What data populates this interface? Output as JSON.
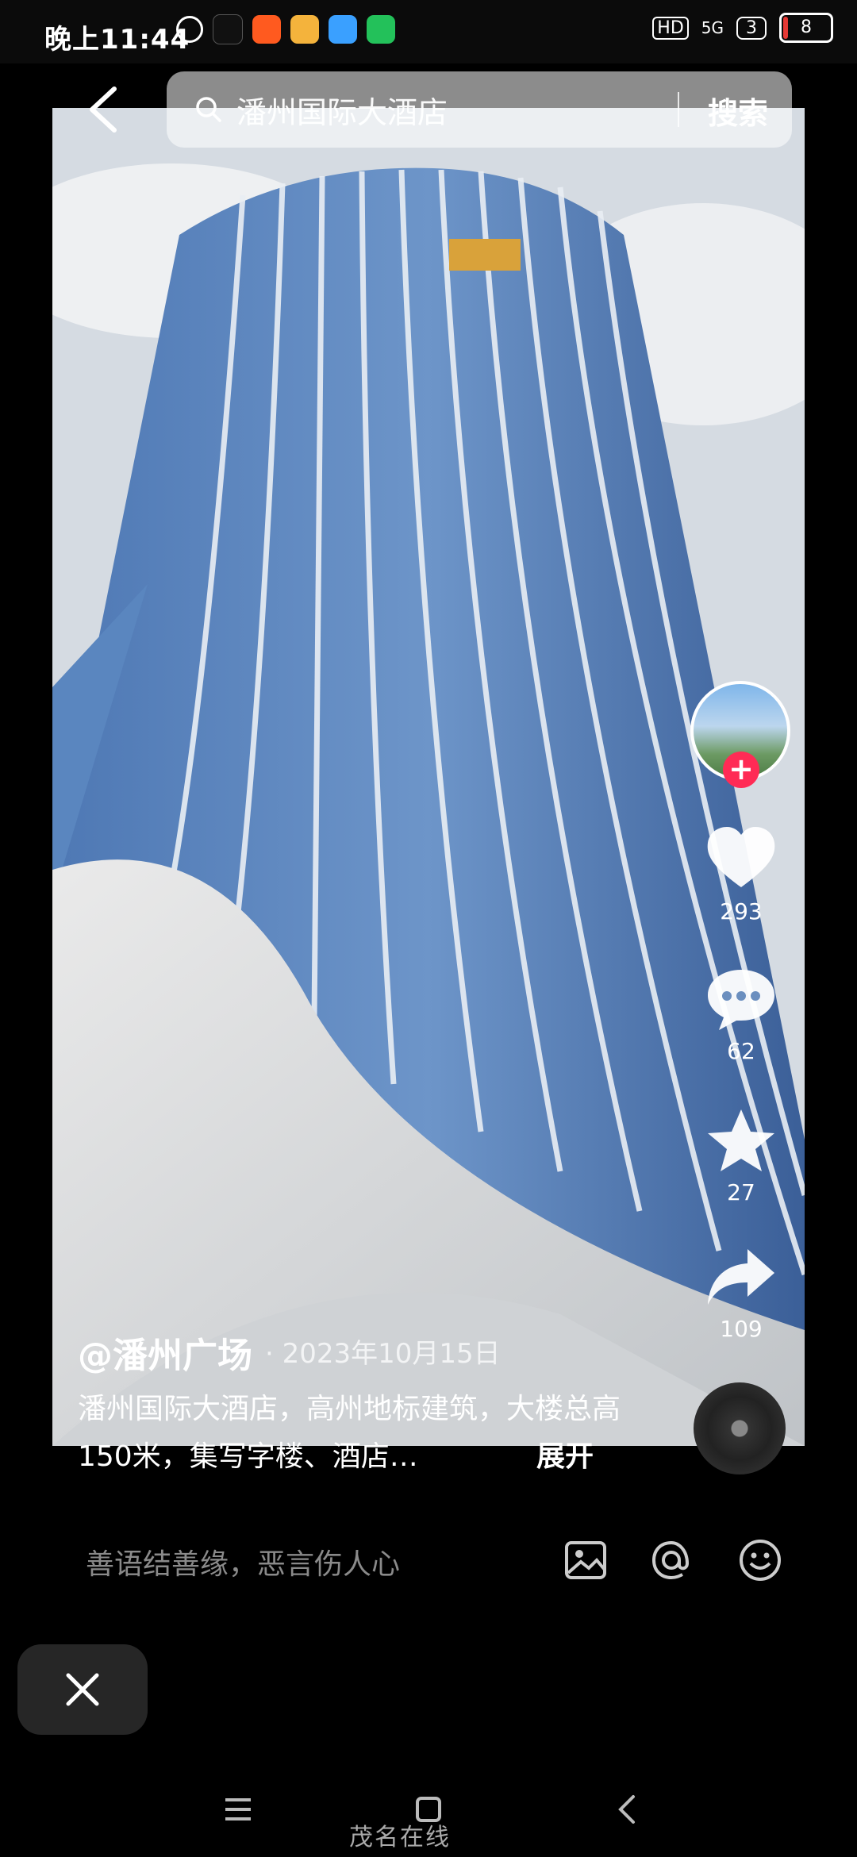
{
  "status_bar": {
    "time": "晚上11:44",
    "battery_level": "8",
    "signal_label": "5G",
    "notification_count": "3"
  },
  "search": {
    "query": "潘州国际大酒店",
    "button_label": "搜索"
  },
  "video": {
    "author": "@潘州广场",
    "date": "· 2023年10月15日",
    "description": "潘州国际大酒店，高州地标建筑，大楼总高150米，集写字楼、酒店…",
    "expand_label": "展开",
    "likes": "293",
    "comments": "62",
    "favorites": "27",
    "shares": "109"
  },
  "comment_bar": {
    "placeholder": "善语结善缘，恶言伤人心"
  },
  "watermark": "茂名在线",
  "colors": {
    "accent_red": "#ff2b55",
    "background": "#000000"
  }
}
